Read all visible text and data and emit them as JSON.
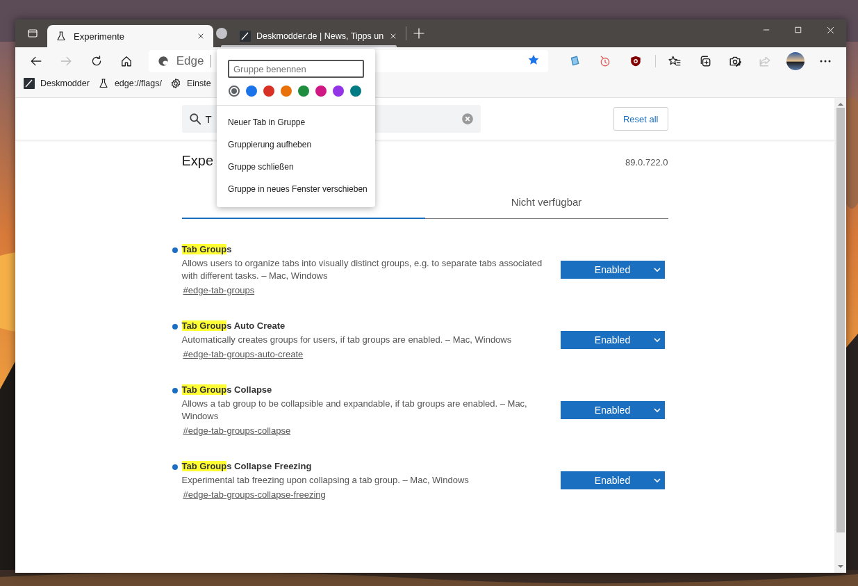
{
  "tabs": [
    {
      "title": "Experimente",
      "kind": "flask",
      "selected": true
    },
    {
      "title": "Deskmodder.de | News, Tipps un",
      "kind": "site",
      "selected": false
    }
  ],
  "address_bar": {
    "text": "Edge"
  },
  "bookmarks": [
    {
      "label": "Deskmodder",
      "kind": "site"
    },
    {
      "label": "edge://flags/",
      "kind": "flask"
    },
    {
      "label": "Einste",
      "kind": "gear"
    }
  ],
  "group_popup": {
    "placeholder": "Gruppe benennen",
    "colors": [
      {
        "color": "#5f6368",
        "selected": true
      },
      {
        "color": "#1a73e8",
        "selected": false
      },
      {
        "color": "#d93025",
        "selected": false
      },
      {
        "color": "#e8710a",
        "selected": false
      },
      {
        "color": "#1e8e3e",
        "selected": false
      },
      {
        "color": "#d01884",
        "selected": false
      },
      {
        "color": "#9334e6",
        "selected": false
      },
      {
        "color": "#007b83",
        "selected": false
      }
    ],
    "items": [
      "Neuer Tab in Gruppe",
      "Gruppierung aufheben",
      "Gruppe schließen",
      "Gruppe in neues Fenster verschieben"
    ]
  },
  "search": {
    "value": "T"
  },
  "reset_button": "Reset all",
  "title": "Expe",
  "version": "89.0.722.0",
  "page_tabs": [
    {
      "selected": true
    },
    {
      "label": "Nicht verfügbar",
      "selected": false
    }
  ],
  "experiments": [
    {
      "highlight": "Tab Group",
      "rest": "s",
      "modified": true,
      "description": "Allows users to organize tabs into visually distinct groups, e.g. to separate tabs associated with different tasks. – Mac, Windows",
      "link": "#edge-tab-groups",
      "value": "Enabled"
    },
    {
      "highlight": "Tab Group",
      "rest": "s Auto Create",
      "modified": true,
      "description": "Automatically creates groups for users, if tab groups are enabled. – Mac, Windows",
      "link": "#edge-tab-groups-auto-create",
      "value": "Enabled"
    },
    {
      "highlight": "Tab Group",
      "rest": "s Collapse",
      "modified": true,
      "description": "Allows a tab group to be collapsible and expandable, if tab groups are enabled. – Mac, Windows",
      "link": "#edge-tab-groups-collapse",
      "value": "Enabled"
    },
    {
      "highlight": "Tab Group",
      "rest": "s Collapse Freezing",
      "modified": true,
      "description": "Experimental tab freezing upon collapsing a tab group. – Mac, Windows",
      "link": "#edge-tab-groups-collapse-freezing",
      "value": "Enabled"
    }
  ]
}
